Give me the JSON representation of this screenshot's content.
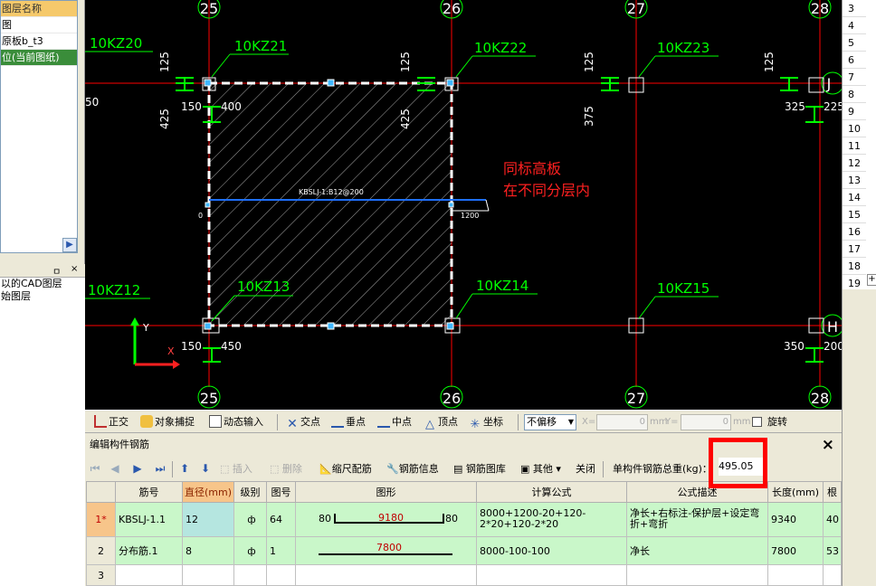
{
  "left_panel": {
    "layer_rows": [
      "图层名称",
      "图",
      "原板b_t3",
      "位(当前图纸)"
    ],
    "cad_panel_pin": "ㅁ",
    "cad_panel_close": "×",
    "cad_rows": [
      "以的CAD图层",
      "始图层"
    ]
  },
  "canvas": {
    "axis_top": [
      "25",
      "26",
      "27",
      "28"
    ],
    "axis_bottom": [
      "25",
      "26",
      "27",
      "28"
    ],
    "axis_right": [
      "J",
      "H"
    ],
    "columns": [
      "10KZ20",
      "10KZ21",
      "10KZ22",
      "10KZ23",
      "10KZ12",
      "10KZ13",
      "10KZ14",
      "10KZ15"
    ],
    "dims": [
      "125",
      "125",
      "125",
      "125",
      "425",
      "425",
      "375",
      "150",
      "400",
      "325",
      "225",
      "150",
      "450",
      "350",
      "200",
      "50"
    ],
    "rebar_label": "KBSLJ-1:B12@200",
    "rebar_left": "0",
    "rebar_right": "1200",
    "note_line1": "同标高板",
    "note_line2": "在不同分层内",
    "ucs_x": "X",
    "ucs_y": "Y"
  },
  "row_numbers": [
    "3",
    "4",
    "5",
    "6",
    "7",
    "8",
    "9",
    "10",
    "11",
    "12",
    "13",
    "14",
    "15",
    "16",
    "17",
    "18",
    "19"
  ],
  "row_plus": "+",
  "snap_bar": {
    "ortho": "正交",
    "osnap": "对象捕捉",
    "dyn": "动态输入",
    "intersection": "交点",
    "perpendicular": "垂点",
    "midpoint": "中点",
    "vertex": "顶点",
    "coordinate": "坐标",
    "offset_mode": "不偏移",
    "x_label": "X=",
    "x_value": "0",
    "x_unit": "mm",
    "y_label": "Y=",
    "y_value": "0",
    "y_unit": "mm",
    "rotate": "旋转"
  },
  "editor": {
    "title": "编辑构件钢筋",
    "close": "×",
    "insert": "插入",
    "delete": "删除",
    "scale": "缩尺配筋",
    "info": "钢筋信息",
    "library": "钢筋图库",
    "other": "其他",
    "close_btn": "关闭",
    "total_label": "单构件钢筋总重(kg)：",
    "total_value": "495.05"
  },
  "table": {
    "headers": [
      "",
      "筋号",
      "直径(mm)",
      "级别",
      "图号",
      "图形",
      "计算公式",
      "公式描述",
      "长度(mm)",
      "根"
    ],
    "rows": [
      {
        "no": "1*",
        "name": "KBSLJ-1.1",
        "diameter": "12",
        "grade": "ф",
        "fig": "64",
        "shape_left": "80",
        "shape_mid": "9180",
        "shape_right": "80",
        "formula": "8000+1200-20+120-2*20+120-2*20",
        "desc": "净长+右标注-保护层+设定弯折+弯折",
        "length": "9340",
        "count": "40"
      },
      {
        "no": "2",
        "name": "分布筋.1",
        "diameter": "8",
        "grade": "ф",
        "fig": "1",
        "shape_left": "",
        "shape_mid": "7800",
        "shape_right": "",
        "formula": "8000-100-100",
        "desc": "净长",
        "length": "7800",
        "count": "53"
      },
      {
        "no": "3",
        "name": "",
        "diameter": "",
        "grade": "",
        "fig": "",
        "shape_left": "",
        "shape_mid": "",
        "shape_right": "",
        "formula": "",
        "desc": "",
        "length": "",
        "count": ""
      }
    ]
  },
  "colors": {
    "grid": "#ff0000",
    "label_green": "#00ff00",
    "slab_border": "#ffffff",
    "rebar_blue": "#1e6fff",
    "note_red": "#ff2020",
    "highlight": "#ff0000"
  }
}
